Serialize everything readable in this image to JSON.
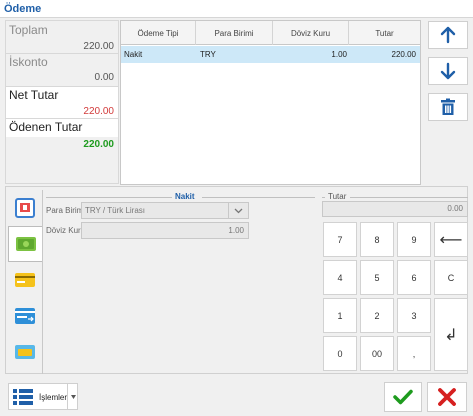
{
  "window": {
    "title": "Ödeme"
  },
  "summary": {
    "toplam_label": "Toplam",
    "toplam_value": "220.00",
    "iskonto_label": "İskonto",
    "iskonto_value": "0.00",
    "net_label": "Net Tutar",
    "net_value": "220.00",
    "odenen_label": "Ödenen Tutar",
    "odenen_value": "220.00"
  },
  "grid": {
    "columns": [
      "Ödeme Tipi",
      "Para Birimi",
      "Döviz Kuru",
      "Tutar"
    ],
    "rows": [
      {
        "odeme_tipi": "Nakit",
        "para_birimi": "TRY",
        "doviz_kuru": "1.00",
        "tutar": "220.00"
      }
    ]
  },
  "nakit": {
    "title": "Nakit",
    "para_birimi_label": "Para Birimi",
    "para_birimi_value": "TRY / Türk Lirası",
    "doviz_kuru_label": "Döviz Kuru",
    "doviz_kuru_value": "1.00"
  },
  "tutar": {
    "title": "Tutar",
    "value": "0.00"
  },
  "keypad": {
    "k7": "7",
    "k8": "8",
    "k9": "9",
    "back": "⟵",
    "k4": "4",
    "k5": "5",
    "k6": "6",
    "clear": "C",
    "k1": "1",
    "k2": "2",
    "k3": "3",
    "enter": "↲",
    "k0": "0",
    "k00": "00",
    "dot": ","
  },
  "footer": {
    "islemler_label": "İşlemler"
  },
  "colors": {
    "accent": "#1f5fa8",
    "red": "#d23b3b",
    "green": "#1e9b1e",
    "selection": "#cde8f8"
  }
}
